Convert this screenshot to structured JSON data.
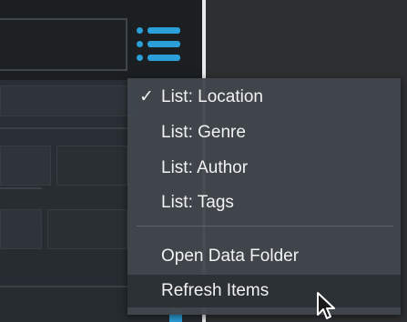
{
  "header": {
    "search_placeholder_text": "",
    "menu_button_icon": "list-menu-icon",
    "accent_color": "#2b9fd8"
  },
  "dropdown": {
    "checkmark": "✓",
    "items": [
      {
        "label": "List: Location",
        "checked": true
      },
      {
        "label": "List: Genre",
        "checked": false
      },
      {
        "label": "List: Author",
        "checked": false
      },
      {
        "label": "List: Tags",
        "checked": false
      },
      {
        "label": "Open Data Folder",
        "checked": false
      },
      {
        "label": "Refresh Items",
        "checked": false,
        "hovered": true
      }
    ]
  }
}
